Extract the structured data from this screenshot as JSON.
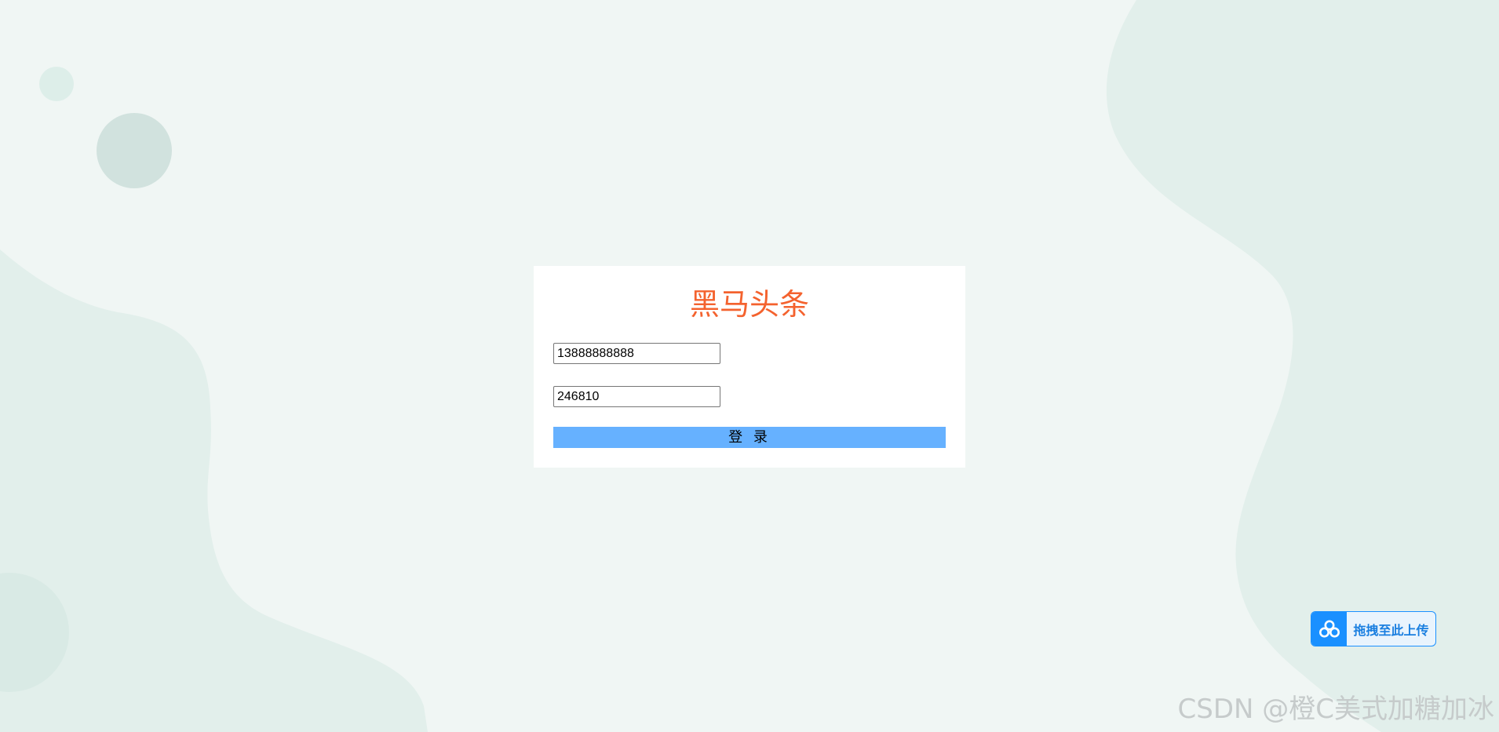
{
  "login": {
    "title": "黑马头条",
    "phone_value": "13888888888",
    "code_value": "246810",
    "submit_label": "登 录"
  },
  "upload_widget": {
    "label": "拖拽至此上传",
    "icon": "cloud-icon"
  },
  "watermark": {
    "text": "CSDN @橙C美式加糖加冰"
  },
  "colors": {
    "background": "#f0f6f4",
    "title": "#f4622e",
    "button": "#66b1ff",
    "upload_accent": "#1a90ff"
  }
}
